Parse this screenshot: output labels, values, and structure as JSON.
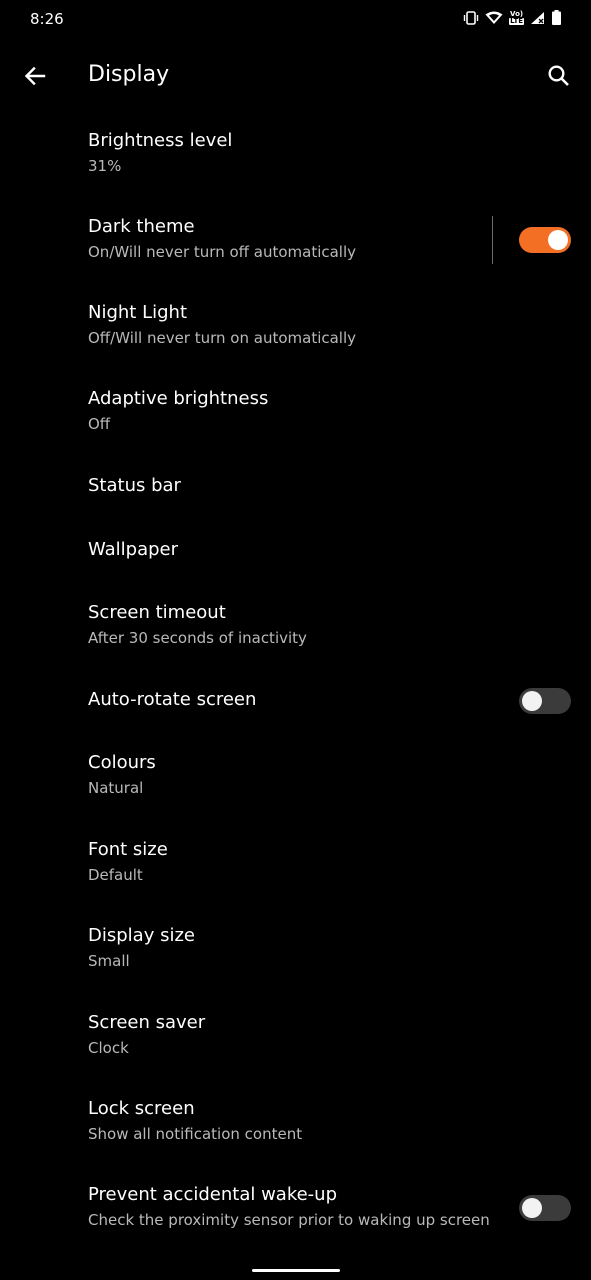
{
  "status_bar": {
    "time": "8:26",
    "icons": [
      "vibrate-icon",
      "wifi-icon",
      "volte-lte-icon",
      "signal-icon",
      "battery-icon"
    ],
    "volte_label": "Vo)",
    "lte_label": "LTE"
  },
  "header": {
    "title": "Display",
    "back_icon": "arrow-left-icon",
    "search_icon": "search-icon"
  },
  "settings": [
    {
      "title": "Brightness level",
      "summary": "31%"
    },
    {
      "title": "Dark theme",
      "summary": "On/Will never turn off automatically",
      "toggle": true
    },
    {
      "title": "Night Light",
      "summary": "Off/Will never turn on automatically"
    },
    {
      "title": "Adaptive brightness",
      "summary": "Off"
    },
    {
      "title": "Status bar",
      "summary": ""
    },
    {
      "title": "Wallpaper",
      "summary": ""
    },
    {
      "title": "Screen timeout",
      "summary": "After 30 seconds of inactivity"
    },
    {
      "title": "Auto-rotate screen",
      "summary": "",
      "toggle": false
    },
    {
      "title": "Colours",
      "summary": "Natural"
    },
    {
      "title": "Font size",
      "summary": "Default"
    },
    {
      "title": "Display size",
      "summary": "Small"
    },
    {
      "title": "Screen saver",
      "summary": "Clock"
    },
    {
      "title": "Lock screen",
      "summary": "Show all notification content"
    },
    {
      "title": "Prevent accidental wake-up",
      "summary": "Check the proximity sensor prior to waking up screen",
      "toggle": false
    }
  ],
  "colors": {
    "background": "#000000",
    "accent": "#f26f23",
    "summary_text": "#b9b9b9"
  }
}
